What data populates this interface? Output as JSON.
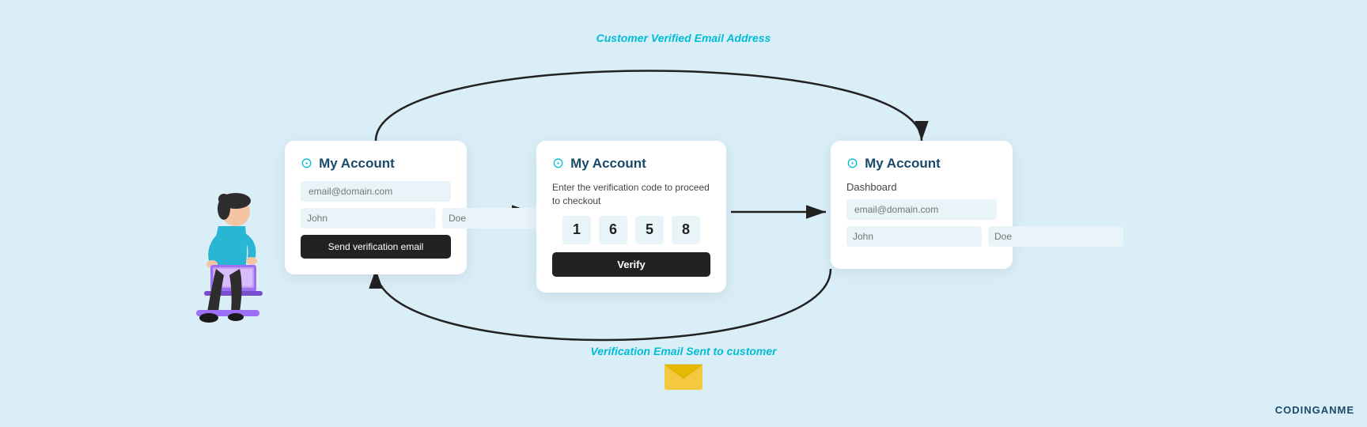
{
  "page": {
    "background": "#daeef8",
    "watermark": "CODINGANME"
  },
  "arrows": {
    "top_label": "Customer Verified Email Address",
    "bottom_label": "Verification Email Sent to customer"
  },
  "card1": {
    "title": "My Account",
    "email_placeholder": "email@domain.com",
    "first_name_placeholder": "John",
    "last_name_placeholder": "Doe",
    "button_label": "Send verification email"
  },
  "card2": {
    "title": "My Account",
    "subtitle": "Enter the verification code to proceed to checkout",
    "otp_digits": [
      "1",
      "6",
      "5",
      "8"
    ],
    "button_label": "Verify"
  },
  "card3": {
    "title": "My Account",
    "dashboard_label": "Dashboard",
    "email_placeholder": "email@domain.com",
    "first_name_placeholder": "John",
    "last_name_placeholder": "Doe"
  },
  "envelope": "✉️",
  "icons": {
    "account": "⊙"
  }
}
